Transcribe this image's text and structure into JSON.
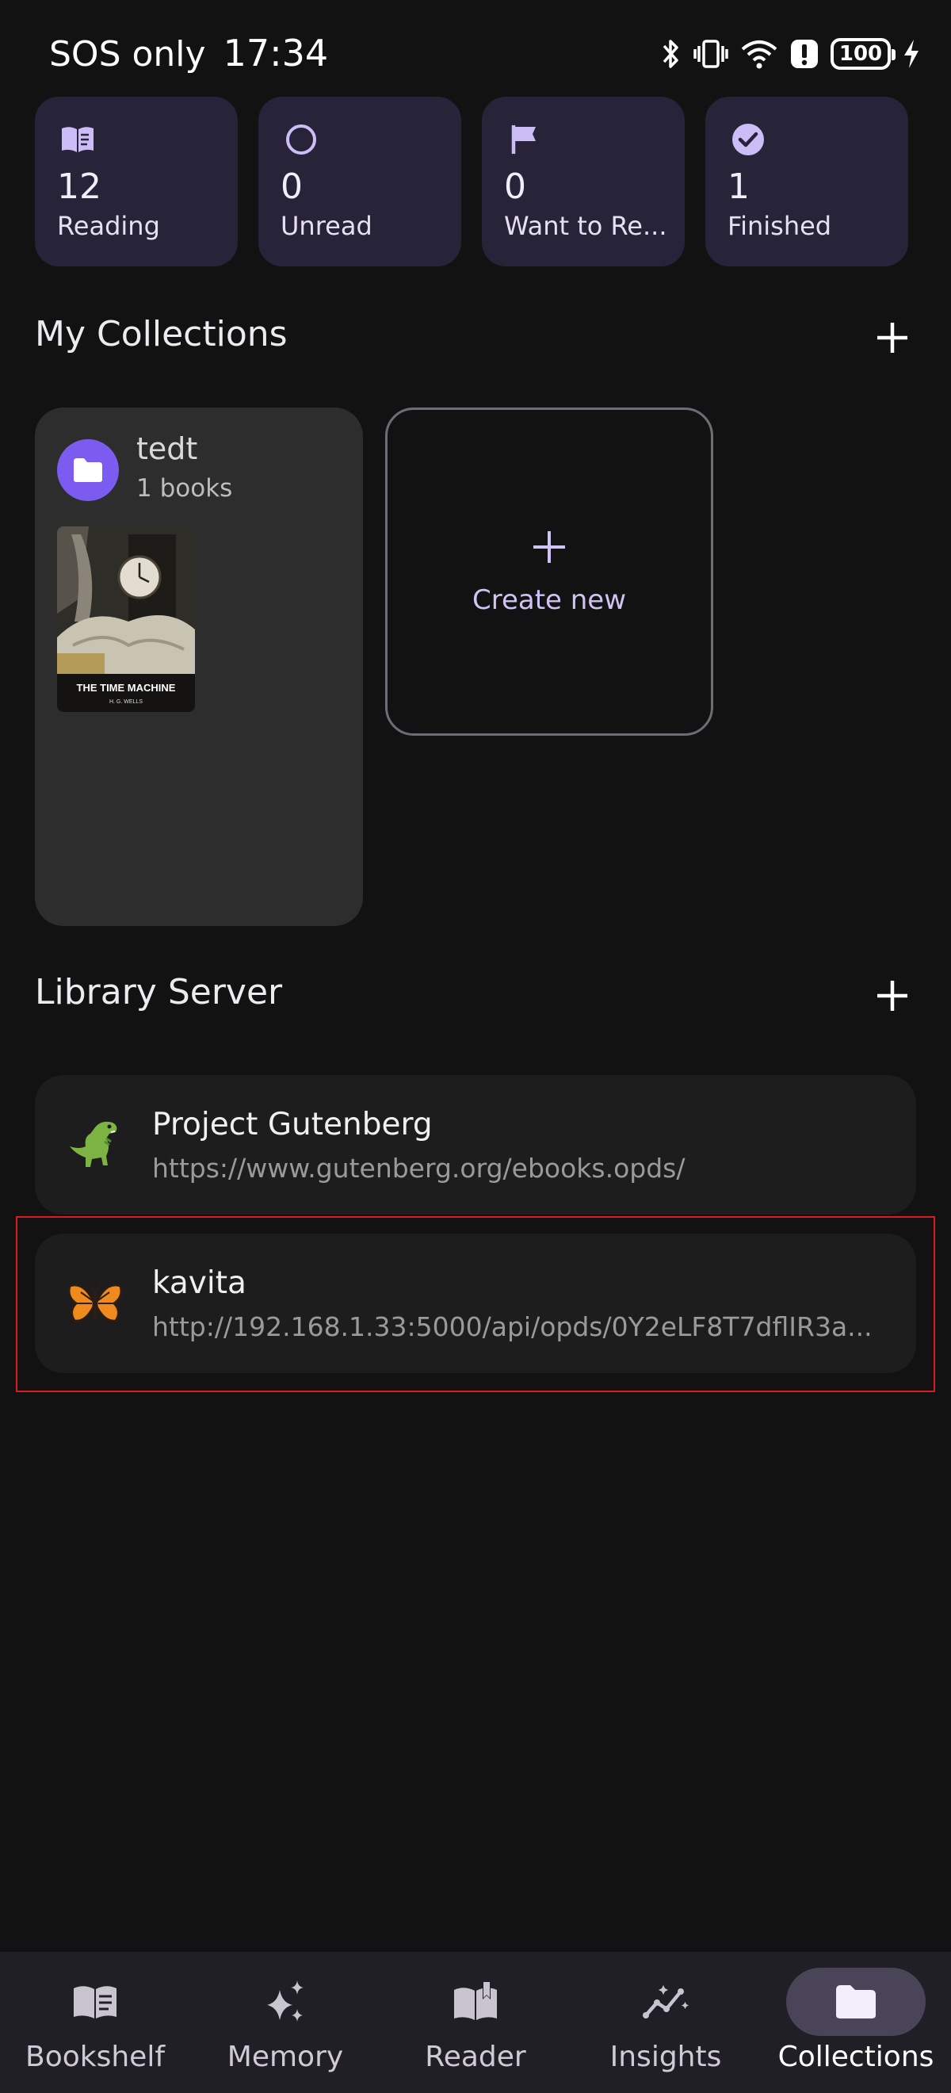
{
  "status_bar": {
    "carrier": "SOS only",
    "time": "17:34",
    "battery": "100",
    "icons": [
      "bluetooth-icon",
      "vibrate-icon",
      "wifi-icon",
      "alert-icon",
      "battery-icon",
      "charging-icon"
    ]
  },
  "stats": [
    {
      "icon": "book-open-icon",
      "count": "12",
      "label": "Reading"
    },
    {
      "icon": "circle-icon",
      "count": "0",
      "label": "Unread"
    },
    {
      "icon": "flag-icon",
      "count": "0",
      "label": "Want to Re..."
    },
    {
      "icon": "check-circle-icon",
      "count": "1",
      "label": "Finished"
    }
  ],
  "collections": {
    "title": "My Collections",
    "items": [
      {
        "name": "tedt",
        "count_label": "1 books",
        "cover_title": "THE TIME MACHINE",
        "cover_author": "H. G. WELLS"
      }
    ],
    "create_label": "Create new"
  },
  "library": {
    "title": "Library Server",
    "servers": [
      {
        "icon": "dinosaur-icon",
        "name": "Project Gutenberg",
        "url": "https://www.gutenberg.org/ebooks.opds/"
      },
      {
        "icon": "butterfly-icon",
        "name": "kavita",
        "url": "http://192.168.1.33:5000/api/opds/0Y2eLF8T7dflIR3a..."
      }
    ]
  },
  "nav": {
    "active": "Collections",
    "items": [
      {
        "icon": "bookshelf-icon",
        "label": "Bookshelf"
      },
      {
        "icon": "sparkle-icon",
        "label": "Memory"
      },
      {
        "icon": "reader-icon",
        "label": "Reader"
      },
      {
        "icon": "insights-icon",
        "label": "Insights"
      },
      {
        "icon": "folder-icon",
        "label": "Collections"
      }
    ]
  },
  "colors": {
    "background": "#121212",
    "stat_card": "#272339",
    "accent": "#7c5cf0",
    "highlight": "#d81e1e"
  }
}
